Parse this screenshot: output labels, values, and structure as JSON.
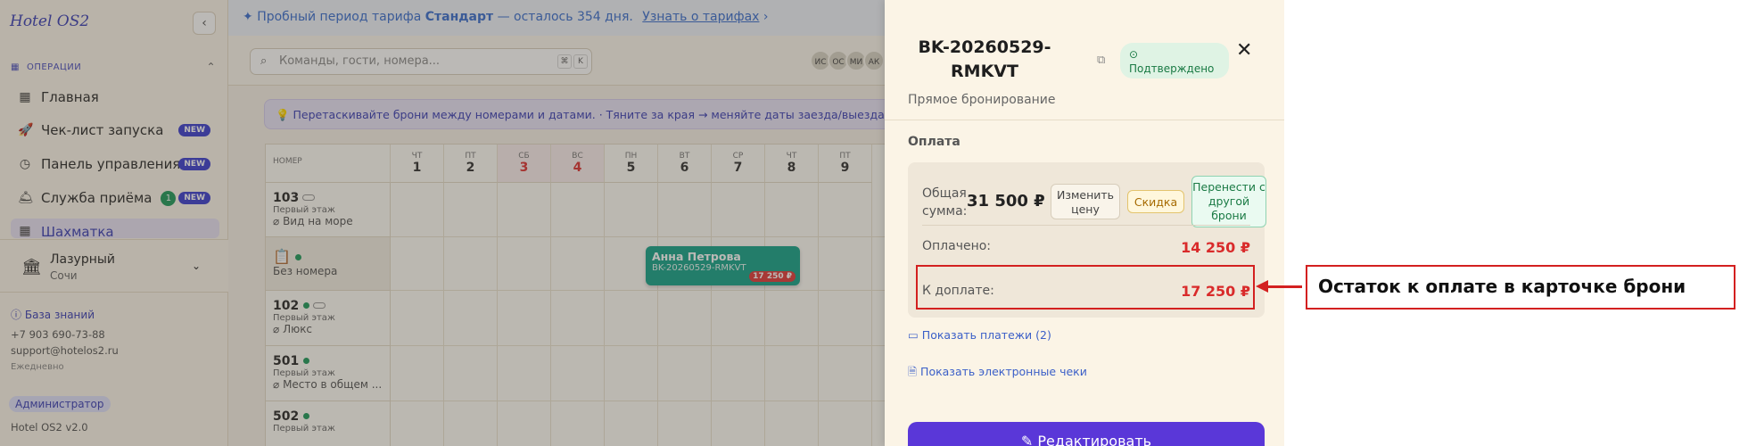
{
  "sidebar": {
    "brand": "Hotel OS2",
    "section": "ОПЕРАЦИИ",
    "items": [
      {
        "label": "Главная"
      },
      {
        "label": "Чек-лист запуска",
        "badge": "NEW"
      },
      {
        "label": "Панель управления",
        "badge": "NEW"
      },
      {
        "label": "Служба приёма",
        "count": "1",
        "badge": "NEW"
      },
      {
        "label": "Шахматка"
      }
    ],
    "hotel_name": "Лазурный",
    "hotel_city": "Сочи",
    "knowledge_base": "База знаний",
    "phone": "+7 903 690-73-88",
    "email": "support@hotelos2.ru",
    "schedule": "Ежедневно",
    "role": "Администратор",
    "version": "Hotel OS2 v2.0"
  },
  "trial": {
    "prefix": "Пробный период тарифа",
    "plan": "Стандарт",
    "suffix": "— осталось 354 дня.",
    "link": "Узнать о тарифах"
  },
  "search": {
    "placeholder": "Команды, гости, номера...",
    "kbd1": "⌘",
    "kbd2": "K"
  },
  "avatars": [
    "ИС",
    "ОС",
    "МИ",
    "АК"
  ],
  "hint": "💡 Перетаскивайте брони между номерами и датами. · Тяните за края → меняйте даты заезда/выезда.",
  "grid": {
    "room_header": "НОМЕР",
    "days": [
      {
        "dow": "ЧТ",
        "num": "1",
        "weekend": false
      },
      {
        "dow": "ПТ",
        "num": "2",
        "weekend": false
      },
      {
        "dow": "СБ",
        "num": "3",
        "weekend": true
      },
      {
        "dow": "ВС",
        "num": "4",
        "weekend": true
      },
      {
        "dow": "ПН",
        "num": "5",
        "weekend": false
      },
      {
        "dow": "ВТ",
        "num": "6",
        "weekend": false
      },
      {
        "dow": "СР",
        "num": "7",
        "weekend": false
      },
      {
        "dow": "ЧТ",
        "num": "8",
        "weekend": false
      },
      {
        "dow": "ПТ",
        "num": "9",
        "weekend": false
      }
    ],
    "rooms": [
      {
        "num": "103",
        "floor": "Первый этаж",
        "type": "Вид на море"
      },
      {
        "num": "📋",
        "floor": "",
        "type": "Без номера"
      },
      {
        "num": "102",
        "floor": "Первый этаж",
        "type": "Люкс"
      },
      {
        "num": "501",
        "floor": "Первый этаж",
        "type": "Место в общем ..."
      },
      {
        "num": "502",
        "floor": "Первый этаж",
        "type": ""
      }
    ]
  },
  "booking": {
    "guest": "Анна Петрова",
    "code": "BK-20260529-RMKVT",
    "amount": "17 250 ₽"
  },
  "drawer": {
    "title": "BK-20260529-RMKVT",
    "status": "Подтверждено",
    "subtitle": "Прямое бронирование",
    "payment_header": "Оплата",
    "total_label": "Общая сумма:",
    "total_value": "31 500 ₽",
    "change_price": "Изменить цену",
    "discount": "Скидка",
    "move_from": "Перенести с другой брони",
    "paid_label": "Оплачено:",
    "paid_value": "14 250 ₽",
    "due_label": "К доплате:",
    "due_value": "17 250 ₽",
    "show_payments": "Показать платежи (2)",
    "show_receipts": "Показать электронные чеки",
    "edit": "Редактировать"
  },
  "callout": "Остаток к оплате в карточке брони"
}
